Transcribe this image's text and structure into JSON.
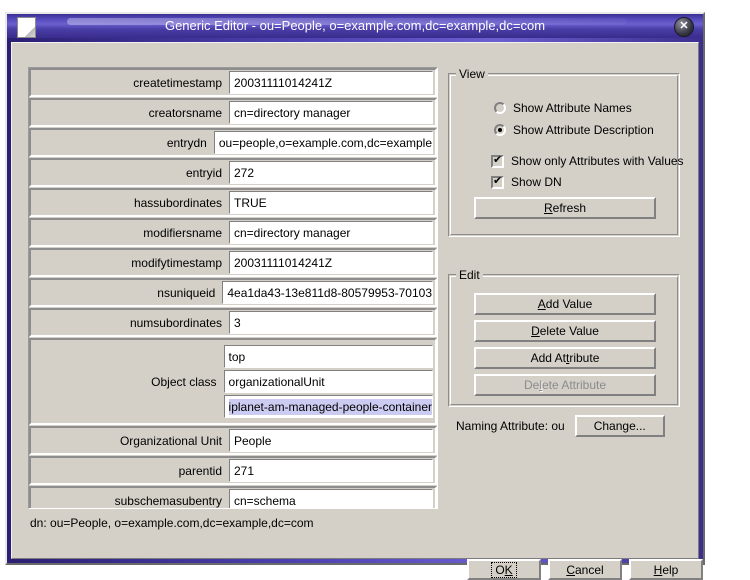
{
  "window": {
    "title": "Generic Editor - ou=People, o=example.com,dc=example,dc=com",
    "close_icon": "close-icon",
    "app_icon": "document-icon"
  },
  "attributes": [
    {
      "label": "createtimestamp",
      "values": [
        "20031111014241Z"
      ]
    },
    {
      "label": "creatorsname",
      "values": [
        "cn=directory manager"
      ]
    },
    {
      "label": "entrydn",
      "values": [
        "ou=people,o=example.com,dc=example"
      ]
    },
    {
      "label": "entryid",
      "values": [
        "272"
      ]
    },
    {
      "label": "hassubordinates",
      "values": [
        "TRUE"
      ]
    },
    {
      "label": "modifiersname",
      "values": [
        "cn=directory manager"
      ]
    },
    {
      "label": "modifytimestamp",
      "values": [
        "20031111014241Z"
      ]
    },
    {
      "label": "nsuniqueid",
      "values": [
        "4ea1da43-13e811d8-80579953-70103"
      ]
    },
    {
      "label": "numsubordinates",
      "values": [
        "3"
      ]
    },
    {
      "label": "Object class",
      "values": [
        "top",
        "organizationalUnit",
        "iplanet-am-managed-people-container"
      ],
      "selected_index": 2
    },
    {
      "label": "Organizational Unit",
      "values": [
        "People"
      ]
    },
    {
      "label": "parentid",
      "values": [
        "271"
      ]
    },
    {
      "label": "subschemasubentry",
      "values": [
        "cn=schema"
      ]
    }
  ],
  "dn_line": "dn: ou=People, o=example.com,dc=example,dc=com",
  "view_group": {
    "title": "View",
    "radios": [
      {
        "label": "Show Attribute Names",
        "checked": false
      },
      {
        "label": "Show Attribute Description",
        "checked": true
      }
    ],
    "checkboxes": [
      {
        "label": "Show only Attributes with Values",
        "checked": true
      },
      {
        "label": "Show DN",
        "checked": true
      }
    ],
    "refresh_button": {
      "pre": "R",
      "post": "efresh"
    }
  },
  "edit_group": {
    "title": "Edit",
    "buttons": [
      {
        "pre": "",
        "mn": "A",
        "post": "dd Value",
        "enabled": true
      },
      {
        "pre": "",
        "mn": "D",
        "post": "elete Value",
        "enabled": true
      },
      {
        "pre": "Add At",
        "mn": "t",
        "post": "ribute",
        "enabled": true
      },
      {
        "pre": "De",
        "mn": "l",
        "post": "ete Attribute",
        "enabled": false
      }
    ]
  },
  "naming": {
    "label": "Naming Attribute: ou",
    "change_button": {
      "pre": "Chan",
      "mn": "g",
      "post": "e..."
    }
  },
  "footer": {
    "ok": {
      "pre": "O",
      "mn": "K",
      "post": ""
    },
    "cancel": {
      "pre": "",
      "mn": "C",
      "post": "ancel"
    },
    "help": {
      "pre": "",
      "mn": "H",
      "post": "elp"
    }
  },
  "colors": {
    "face": "#d4d0c8",
    "title_bar": "#4b3fae",
    "selection": "#ccccf2",
    "field_bg": "#ffffff"
  }
}
